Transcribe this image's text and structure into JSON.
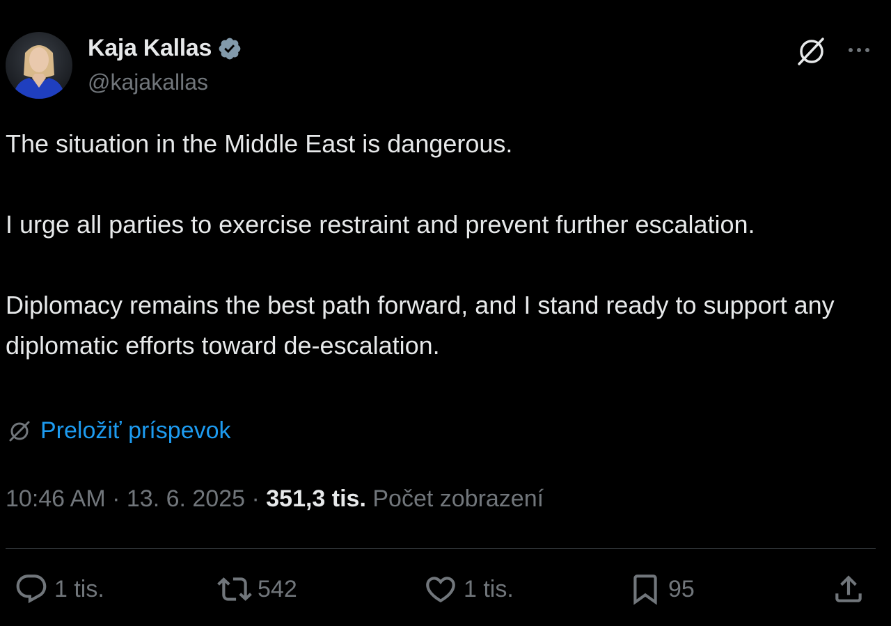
{
  "author": {
    "display_name": "Kaja Kallas",
    "handle": "@kajakallas",
    "verified": true
  },
  "tweet": {
    "paragraphs": [
      "The situation in the Middle East is dangerous.",
      "I urge all parties to exercise restraint and prevent further escalation.",
      "Diplomacy remains the best path forward, and I stand ready to support any diplomatic efforts toward de-escalation."
    ],
    "translate_label": "Preložiť príspevok"
  },
  "meta": {
    "time": "10:46 AM",
    "separator": " · ",
    "date": "13. 6. 2025",
    "views_count": "351,3 tis.",
    "views_label": "Počet zobrazení"
  },
  "actions": {
    "replies": "1 tis.",
    "reposts": "542",
    "likes": "1 tis.",
    "bookmarks": "95"
  },
  "colors": {
    "background": "#000000",
    "text": "#e7e9ea",
    "secondary": "#71767b",
    "link": "#1d9bf0",
    "verified_badge": "#829aab"
  },
  "icons": {
    "verified": "verified-badge-icon",
    "grok": "grok-icon",
    "more": "more-dots-icon",
    "translate": "translate-icon",
    "reply": "reply-icon",
    "repost": "repost-icon",
    "like": "heart-icon",
    "bookmark": "bookmark-icon",
    "share": "share-icon"
  }
}
